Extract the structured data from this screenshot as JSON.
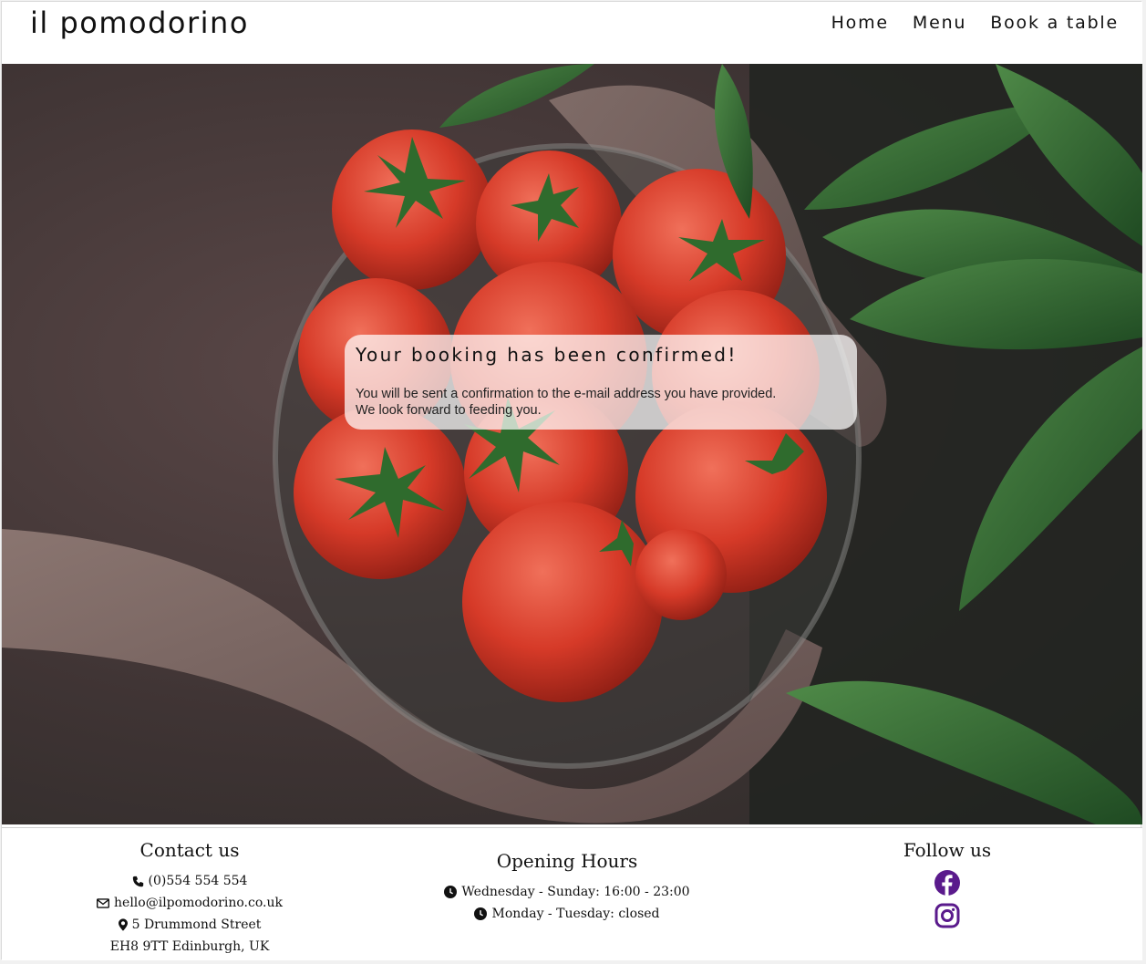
{
  "brand": {
    "name": "il pomodorino"
  },
  "nav": {
    "items": [
      {
        "label": "Home"
      },
      {
        "label": "Menu"
      },
      {
        "label": "Book a table"
      }
    ]
  },
  "notice": {
    "heading": "Your booking has been confirmed!",
    "line1": "You will be sent a confirmation to the e-mail address you have provided.",
    "line2": "We look forward to feeding you."
  },
  "footer": {
    "contact": {
      "heading": "Contact us",
      "phone": "(0)554 554 554",
      "email": "hello@ilpomodorino.co.uk",
      "address_line1": "5 Drummond Street",
      "address_line2": "EH8 9TT Edinburgh, UK"
    },
    "hours": {
      "heading": "Opening Hours",
      "line1": "Wednesday - Sunday: 16:00 - 23:00",
      "line2": "Monday - Tuesday: closed"
    },
    "follow": {
      "heading": "Follow us",
      "icons": [
        "facebook-icon",
        "instagram-icon"
      ],
      "icon_color": "#5a1a8c"
    }
  },
  "hero": {
    "image": "hands holding a glass bowl of tomatoes beside green leaves"
  }
}
